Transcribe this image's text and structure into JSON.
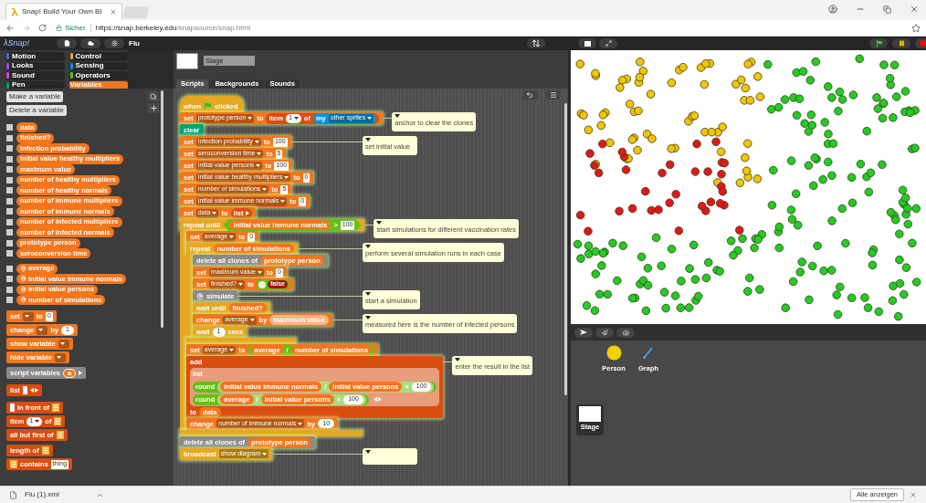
{
  "browser": {
    "tab_title": "Snap! Build Your Own Bl",
    "security": "Sicher",
    "url_host": "https://snap.berkeley.edu",
    "url_path": "/snapsource/snap.html"
  },
  "toolbar": {
    "logo": "λSnap!",
    "project": "Flu"
  },
  "categories": [
    {
      "label": "Motion",
      "color": "#4a6cd4",
      "selected": false
    },
    {
      "label": "Control",
      "color": "#e6a822",
      "selected": false
    },
    {
      "label": "Looks",
      "color": "#8f56e3",
      "selected": false
    },
    {
      "label": "Sensing",
      "color": "#0494dc",
      "selected": false
    },
    {
      "label": "Sound",
      "color": "#cf4ad9",
      "selected": false
    },
    {
      "label": "Operators",
      "color": "#62c213",
      "selected": false
    },
    {
      "label": "Pen",
      "color": "#00a178",
      "selected": false
    },
    {
      "label": "Variables",
      "color": "#f3761d",
      "selected": true
    }
  ],
  "palette": {
    "buttons": [
      "Make a variable",
      "Delete a variable"
    ],
    "variables": [
      {
        "name": "data",
        "kind": "global",
        "checked": false
      },
      {
        "name": "finished?",
        "kind": "global",
        "checked": false
      },
      {
        "name": "infection probability",
        "kind": "global",
        "checked": false
      },
      {
        "name": "initial value healthy multipliers",
        "kind": "global",
        "checked": false
      },
      {
        "name": "maximum value",
        "kind": "global",
        "checked": false
      },
      {
        "name": "number of healthy multipliers",
        "kind": "global",
        "checked": false
      },
      {
        "name": "number of healthy normals",
        "kind": "global",
        "checked": false
      },
      {
        "name": "number of immune multipliers",
        "kind": "global",
        "checked": false
      },
      {
        "name": "number of immune normals",
        "kind": "global",
        "checked": false
      },
      {
        "name": "number of infected multipliers",
        "kind": "global",
        "checked": false
      },
      {
        "name": "number of infected normals",
        "kind": "global",
        "checked": false
      },
      {
        "name": "prototype person",
        "kind": "global",
        "checked": false
      },
      {
        "name": "seroconversion time",
        "kind": "global",
        "checked": false
      },
      {
        "name": "average",
        "kind": "sprite",
        "checked": false
      },
      {
        "name": "initial value immune normals",
        "kind": "sprite",
        "checked": false
      },
      {
        "name": "initial value persons",
        "kind": "sprite",
        "checked": false
      },
      {
        "name": "number of simulations",
        "kind": "sprite",
        "checked": false
      }
    ],
    "groups": [
      [
        {
          "color": "#f3761d",
          "parts": [
            {
              "kind": "label",
              "text": "set"
            },
            {
              "kind": "menu"
            },
            {
              "kind": "label",
              "text": "to"
            },
            {
              "kind": "text",
              "text": "0"
            }
          ]
        },
        {
          "color": "#f3761d",
          "parts": [
            {
              "kind": "label",
              "text": "change"
            },
            {
              "kind": "menu"
            },
            {
              "kind": "label",
              "text": "by"
            },
            {
              "kind": "num",
              "text": "1"
            }
          ]
        },
        {
          "color": "#f3761d",
          "parts": [
            {
              "kind": "label",
              "text": "show variable"
            },
            {
              "kind": "menu"
            }
          ]
        },
        {
          "color": "#f3761d",
          "parts": [
            {
              "kind": "label",
              "text": "hide variable"
            },
            {
              "kind": "menu"
            }
          ]
        }
      ],
      [
        {
          "color": "#8a8a8a",
          "parts": [
            {
              "kind": "label",
              "text": "script variables"
            },
            {
              "kind": "upvar",
              "text": "a"
            },
            {
              "kind": "arrow_right"
            }
          ]
        }
      ],
      [
        {
          "color": "#d94d11",
          "parts": [
            {
              "kind": "label",
              "text": "list"
            },
            {
              "kind": "blank"
            },
            {
              "kind": "arrows"
            }
          ]
        }
      ],
      [
        {
          "color": "#d94d11",
          "parts": [
            {
              "kind": "blank"
            },
            {
              "kind": "label",
              "text": "in front of"
            },
            {
              "kind": "list_slot"
            }
          ]
        },
        {
          "color": "#d94d11",
          "parts": [
            {
              "kind": "label",
              "text": "item"
            },
            {
              "kind": "num_menu",
              "text": "1"
            },
            {
              "kind": "label",
              "text": "of"
            },
            {
              "kind": "list_slot"
            }
          ]
        },
        {
          "color": "#d94d11",
          "parts": [
            {
              "kind": "label",
              "text": "all but first of"
            },
            {
              "kind": "list_slot"
            }
          ]
        }
      ],
      [
        {
          "color": "#d94d11",
          "parts": [
            {
              "kind": "label",
              "text": "length of"
            },
            {
              "kind": "list_slot"
            }
          ]
        },
        {
          "color": "#d94d11",
          "parts": [
            {
              "kind": "list_slot"
            },
            {
              "kind": "label",
              "text": "contains"
            },
            {
              "kind": "text",
              "text": "thing"
            }
          ]
        }
      ]
    ]
  },
  "sprite": {
    "name": "Stage",
    "tabs": [
      {
        "label": "Scripts",
        "selected": true
      },
      {
        "label": "Backgrounds",
        "selected": false
      },
      {
        "label": "Sounds",
        "selected": false
      }
    ]
  },
  "script": {
    "running": true,
    "blocks": [
      {
        "color": "#e6a822",
        "hat": true,
        "parts": [
          {
            "kind": "label",
            "text": "when"
          },
          {
            "kind": "flag"
          },
          {
            "kind": "label",
            "text": "clicked"
          }
        ]
      },
      {
        "color": "#f3761d",
        "parts": [
          {
            "kind": "label",
            "text": "set"
          },
          {
            "kind": "menu",
            "text": "prototype person"
          },
          {
            "kind": "label",
            "text": "to"
          },
          {
            "kind": "reporter",
            "color": "#d94d11",
            "parts": [
              {
                "kind": "label",
                "text": "item"
              },
              {
                "kind": "num_menu",
                "text": "1"
              },
              {
                "kind": "label",
                "text": "of"
              },
              {
                "kind": "reporter",
                "color": "#0494dc",
                "parts": [
                  {
                    "kind": "label",
                    "text": "my"
                  },
                  {
                    "kind": "menu",
                    "text": "other sprites"
                  }
                ]
              }
            ]
          }
        ],
        "comment": {
          "kind": "note",
          "text": "anchor to clear the clones"
        }
      },
      {
        "color": "#00a178",
        "parts": [
          {
            "kind": "label",
            "text": "clear"
          }
        ]
      },
      {
        "color": "#f3761d",
        "parts": [
          {
            "kind": "label",
            "text": "set"
          },
          {
            "kind": "menu",
            "text": "infection probability"
          },
          {
            "kind": "label",
            "text": "to"
          },
          {
            "kind": "text",
            "text": "100"
          }
        ],
        "comment": {
          "kind": "note",
          "text": "set initial value"
        }
      },
      {
        "color": "#f3761d",
        "parts": [
          {
            "kind": "label",
            "text": "set"
          },
          {
            "kind": "menu",
            "text": "seroconversion time"
          },
          {
            "kind": "label",
            "text": "to"
          },
          {
            "kind": "text",
            "text": "5"
          }
        ]
      },
      {
        "color": "#f3761d",
        "parts": [
          {
            "kind": "label",
            "text": "set"
          },
          {
            "kind": "menu",
            "text": "initial value persons"
          },
          {
            "kind": "label",
            "text": "to"
          },
          {
            "kind": "text",
            "text": "100"
          }
        ]
      },
      {
        "color": "#f3761d",
        "parts": [
          {
            "kind": "label",
            "text": "set"
          },
          {
            "kind": "menu",
            "text": "initial value healthy multipliers"
          },
          {
            "kind": "label",
            "text": "to"
          },
          {
            "kind": "text",
            "text": "0"
          }
        ]
      },
      {
        "color": "#f3761d",
        "parts": [
          {
            "kind": "label",
            "text": "set"
          },
          {
            "kind": "menu",
            "text": "number of simulations"
          },
          {
            "kind": "label",
            "text": "to"
          },
          {
            "kind": "text",
            "text": "5"
          }
        ]
      },
      {
        "color": "#f3761d",
        "parts": [
          {
            "kind": "label",
            "text": "set"
          },
          {
            "kind": "menu",
            "text": "initial value immune normals"
          },
          {
            "kind": "label",
            "text": "to"
          },
          {
            "kind": "text",
            "text": "0"
          }
        ]
      },
      {
        "color": "#f3761d",
        "parts": [
          {
            "kind": "label",
            "text": "set"
          },
          {
            "kind": "menu",
            "text": "data"
          },
          {
            "kind": "label",
            "text": "to"
          },
          {
            "kind": "reporter",
            "color": "#d94d11",
            "parts": [
              {
                "kind": "label",
                "text": "list"
              },
              {
                "kind": "arrow_right"
              }
            ]
          }
        ]
      },
      {
        "color": "#e6a822",
        "parts": [
          {
            "kind": "label",
            "text": "repeat until"
          },
          {
            "kind": "predicate",
            "color": "#62c213",
            "parts": [
              {
                "kind": "var",
                "text": "initial value immune normals"
              },
              {
                "kind": "label",
                "text": ">"
              },
              {
                "kind": "text",
                "text": "100"
              }
            ]
          }
        ],
        "comment": {
          "kind": "note",
          "text": "start simulations for different vaccination rates"
        },
        "children": [
          {
            "color": "#f3761d",
            "parts": [
              {
                "kind": "label",
                "text": "set"
              },
              {
                "kind": "menu",
                "text": "average"
              },
              {
                "kind": "label",
                "text": "to"
              },
              {
                "kind": "text",
                "text": "0"
              }
            ]
          },
          {
            "color": "#e6a822",
            "parts": [
              {
                "kind": "label",
                "text": "repeat"
              },
              {
                "kind": "var",
                "text": "number of simulations"
              }
            ],
            "comment": {
              "kind": "note",
              "text": "perform several simulation runs in each case"
            },
            "children": [
              {
                "color": "#8a8a8a",
                "parts": [
                  {
                    "kind": "label",
                    "text": "delete all clones of"
                  },
                  {
                    "kind": "var",
                    "text": "prototype person"
                  }
                ]
              },
              {
                "color": "#f3761d",
                "parts": [
                  {
                    "kind": "label",
                    "text": "set"
                  },
                  {
                    "kind": "menu",
                    "text": "maximum value"
                  },
                  {
                    "kind": "label",
                    "text": "to"
                  },
                  {
                    "kind": "text",
                    "text": "0"
                  }
                ]
              },
              {
                "color": "#f3761d",
                "parts": [
                  {
                    "kind": "label",
                    "text": "set"
                  },
                  {
                    "kind": "menu",
                    "text": "finished?"
                  },
                  {
                    "kind": "label",
                    "text": "to"
                  },
                  {
                    "kind": "toggle",
                    "text": "false",
                    "on": false
                  }
                ]
              },
              {
                "color": "#8a8a8a",
                "parts": [
                  {
                    "kind": "pin"
                  },
                  {
                    "kind": "label",
                    "text": "simulate"
                  }
                ],
                "comment": {
                  "kind": "note",
                  "text": "start a simulation"
                }
              },
              {
                "color": "#e6a822",
                "parts": [
                  {
                    "kind": "label",
                    "text": "wait until"
                  },
                  {
                    "kind": "var",
                    "text": "finished?"
                  }
                ]
              },
              {
                "color": "#f3761d",
                "parts": [
                  {
                    "kind": "label",
                    "text": "change"
                  },
                  {
                    "kind": "menu",
                    "text": "average"
                  },
                  {
                    "kind": "label",
                    "text": "by"
                  },
                  {
                    "kind": "var",
                    "text": "maximum value",
                    "zebra": true
                  }
                ],
                "comment": {
                  "kind": "note",
                  "text": "measured here is the number of infected persons"
                }
              },
              {
                "color": "#e6a822",
                "parts": [
                  {
                    "kind": "label",
                    "text": "wait"
                  },
                  {
                    "kind": "num",
                    "text": "1"
                  },
                  {
                    "kind": "label",
                    "text": "secs"
                  }
                ]
              }
            ]
          },
          {
            "color": "#f3761d",
            "parts": [
              {
                "kind": "label",
                "text": "set"
              },
              {
                "kind": "menu",
                "text": "average"
              },
              {
                "kind": "label",
                "text": "to"
              },
              {
                "kind": "reporter",
                "color": "#62c213",
                "parts": [
                  {
                    "kind": "var",
                    "text": "average"
                  },
                  {
                    "kind": "label",
                    "text": "/"
                  },
                  {
                    "kind": "var",
                    "text": "number of simulations"
                  }
                ]
              }
            ]
          },
          {
            "color": "#d94d11",
            "lines": [
              [
                {
                  "kind": "label",
                  "text": "add"
                }
              ],
              [
                {
                  "kind": "list_rows",
                  "label": "list",
                  "zebra": true,
                  "rows": [
                    [
                      {
                        "kind": "reporter",
                        "color": "#62c213",
                        "parts": [
                          {
                            "kind": "label",
                            "text": "round"
                          },
                          {
                            "kind": "reporter",
                            "zebra": true,
                            "parts": [
                              {
                                "kind": "var",
                                "text": "initial value immune normals"
                              },
                              {
                                "kind": "label",
                                "text": "/"
                              },
                              {
                                "kind": "var",
                                "text": "initial value persons"
                              },
                              {
                                "kind": "label",
                                "text": "×"
                              },
                              {
                                "kind": "num",
                                "text": "100"
                              }
                            ]
                          }
                        ]
                      }
                    ],
                    [
                      {
                        "kind": "reporter",
                        "color": "#62c213",
                        "parts": [
                          {
                            "kind": "label",
                            "text": "round"
                          },
                          {
                            "kind": "reporter",
                            "zebra": true,
                            "parts": [
                              {
                                "kind": "var",
                                "text": "average"
                              },
                              {
                                "kind": "label",
                                "text": "/"
                              },
                              {
                                "kind": "var",
                                "text": "initial value persons"
                              },
                              {
                                "kind": "label",
                                "text": "×"
                              },
                              {
                                "kind": "num",
                                "text": "100"
                              }
                            ]
                          }
                        ]
                      },
                      {
                        "kind": "arrows"
                      }
                    ]
                  ]
                }
              ],
              [
                {
                  "kind": "label",
                  "text": "to"
                },
                {
                  "kind": "var",
                  "text": "data"
                }
              ]
            ],
            "comment": {
              "kind": "note",
              "text": "enter the result in the list"
            }
          },
          {
            "color": "#f3761d",
            "parts": [
              {
                "kind": "label",
                "text": "change"
              },
              {
                "kind": "menu",
                "text": "number of immune normals"
              },
              {
                "kind": "label",
                "text": "by"
              },
              {
                "kind": "num",
                "text": "10"
              }
            ]
          }
        ]
      },
      {
        "color": "#8a8a8a",
        "parts": [
          {
            "kind": "label",
            "text": "delete all clones of"
          },
          {
            "kind": "var",
            "text": "prototype person"
          }
        ]
      },
      {
        "color": "#e6a822",
        "parts": [
          {
            "kind": "label",
            "text": "broadcast"
          },
          {
            "kind": "menu",
            "text": "show diagram"
          }
        ],
        "comment": {
          "kind": "note"
        }
      }
    ]
  },
  "corral": {
    "sprites": [
      {
        "name": "Person",
        "kind": "circle"
      },
      {
        "name": "Graph",
        "kind": "pencil"
      }
    ],
    "stage_label": "Stage"
  },
  "downloads": {
    "file": "Flu (1).xml",
    "show_all": "Alle anzeigen"
  }
}
